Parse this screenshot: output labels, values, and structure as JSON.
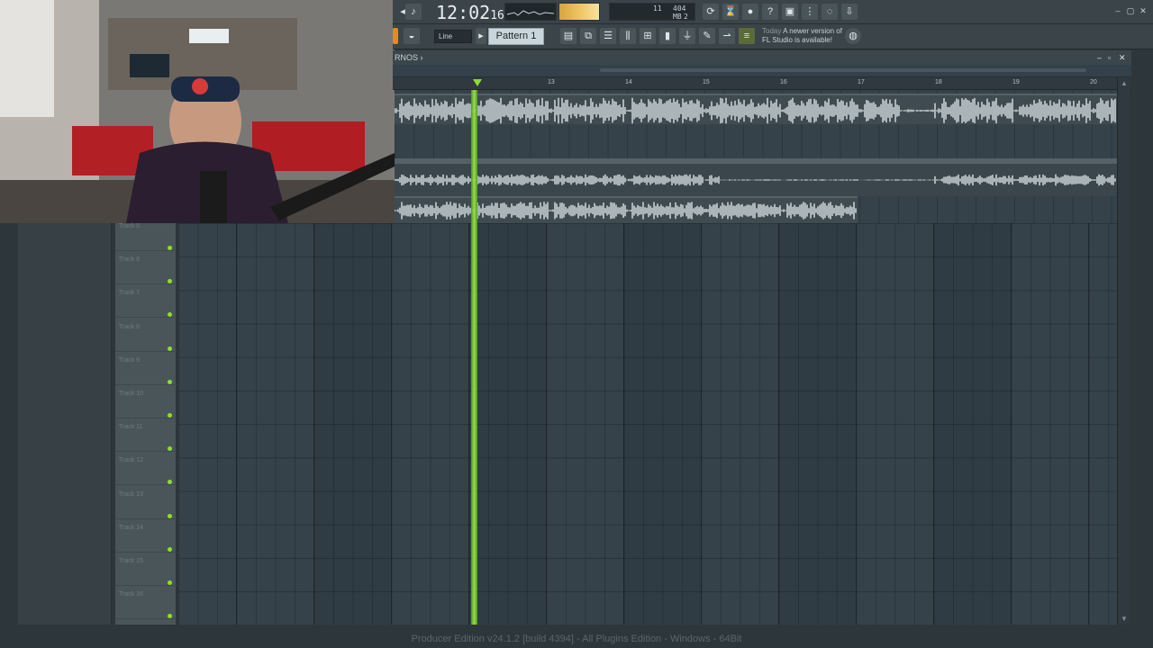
{
  "app": {
    "title": "FL Studio"
  },
  "toolbar": {
    "time_main": "12:02",
    "time_sub": "16",
    "cpu_value": "11",
    "memory": "404 MB",
    "poly": "2",
    "snap_mode": "Line",
    "pattern": "Pattern 1",
    "news_today": "Today",
    "news_line1": "A newer version of",
    "news_line2": "FL Studio is available!"
  },
  "playlist": {
    "title": "RNOS ›",
    "ruler_ticks": [
      "13",
      "14",
      "15",
      "16",
      "17",
      "18",
      "19",
      "20"
    ],
    "track_labels": [
      "Track 5",
      "Track 6",
      "Track 7",
      "Track 8",
      "Track 9",
      "Track 10",
      "Track 11",
      "Track 12",
      "Track 13",
      "Track 14",
      "Track 15",
      "Track 16"
    ]
  },
  "status": {
    "text": "Producer Edition v24.1.2 [build 4394] - All Plugins Edition - Windows - 64Bit"
  },
  "colors": {
    "accent_green": "#8fdc2f",
    "grid_bg": "#35424a",
    "pattern_bg": "#c9d6dc"
  }
}
